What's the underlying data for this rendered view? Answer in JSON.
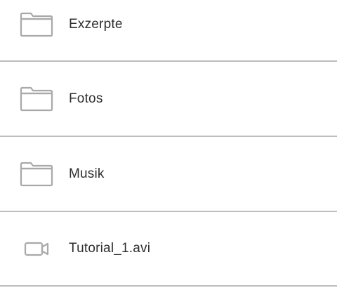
{
  "file_list": {
    "items": [
      {
        "name": "Exzerpte",
        "type": "folder",
        "icon": "folder-icon"
      },
      {
        "name": "Fotos",
        "type": "folder",
        "icon": "folder-icon"
      },
      {
        "name": "Musik",
        "type": "folder",
        "icon": "folder-icon"
      },
      {
        "name": "Tutorial_1.avi",
        "type": "video",
        "icon": "video-icon"
      }
    ],
    "colors": {
      "icon_stroke": "#a9a9a9",
      "divider": "#bdbdbd",
      "text": "#2e2e2e",
      "background": "#ffffff"
    }
  }
}
